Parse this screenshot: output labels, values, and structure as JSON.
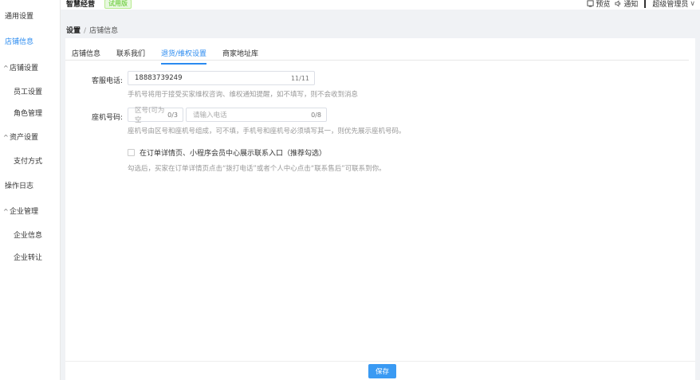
{
  "sidebar": {
    "items": [
      {
        "label": "通用设置",
        "type": "item"
      },
      {
        "label": "店铺信息",
        "type": "item",
        "active": true
      },
      {
        "label": "店铺设置",
        "type": "group"
      },
      {
        "label": "员工设置",
        "type": "sub"
      },
      {
        "label": "角色管理",
        "type": "sub"
      },
      {
        "label": "资产设置",
        "type": "group"
      },
      {
        "label": "支付方式",
        "type": "sub"
      },
      {
        "label": "操作日志",
        "type": "item"
      },
      {
        "label": "企业管理",
        "type": "group"
      },
      {
        "label": "企业信息",
        "type": "sub"
      },
      {
        "label": "企业转让",
        "type": "sub"
      }
    ],
    "group_chevron": "^"
  },
  "header": {
    "brand": "智慧经营",
    "trial_badge": "试用版",
    "preview_label": "预览",
    "notify_label": "通知",
    "user_label": "超级管理员",
    "user_chevron": "∨"
  },
  "breadcrumb": {
    "root": "设置",
    "separator": "/",
    "current": "店铺信息"
  },
  "tabs": [
    {
      "label": "店铺信息"
    },
    {
      "label": "联系我们"
    },
    {
      "label": "退货/维权设置",
      "active": true
    },
    {
      "label": "商家地址库"
    }
  ],
  "form": {
    "service_phone": {
      "label": "客服电话:",
      "value": "18883739249",
      "counter": "11/11",
      "hint": "手机号将用于接受买家维权咨询、维权通知提醒，如不填写，则不会收到消息"
    },
    "landline": {
      "label": "座机号码:",
      "area_placeholder": "区号(可为空",
      "area_counter": "0/3",
      "number_placeholder": "请输入电话",
      "number_counter": "0/8",
      "hint": "座机号由区号和座机号组成，可不填，手机号和座机号必须填写其一，则优先展示座机号码。"
    },
    "show_entry": {
      "label": "在订单详情页、小程序会员中心展示联系入口（推荐勾选）",
      "checked": false,
      "hint": "勾选后，买家在订单详情页点击“拨打电话”或者个人中心点击“联系售后”可联系到你。"
    }
  },
  "footer": {
    "save_label": "保存"
  },
  "colors": {
    "accent": "#2b8bf0",
    "button": "#3a9af3",
    "trial_green": "#52c41a"
  }
}
